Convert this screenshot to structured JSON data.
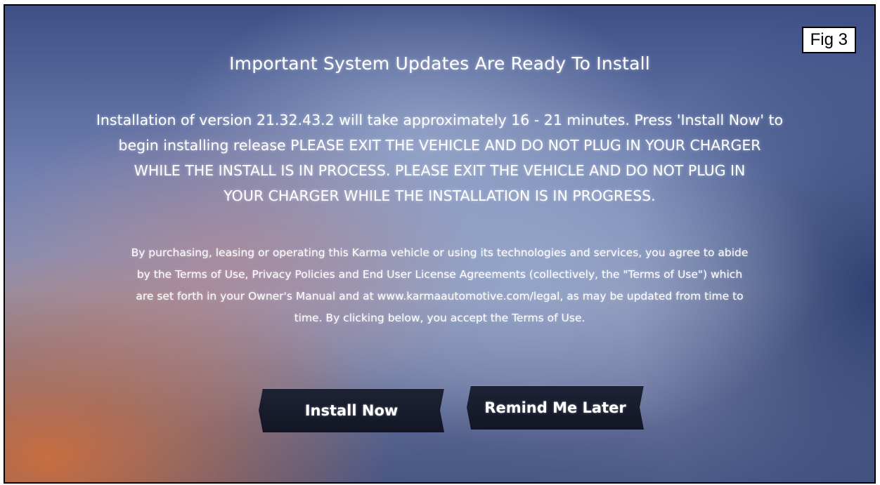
{
  "figure_label": "Fig 3",
  "dialog": {
    "title": "Important System Updates Are Ready To Install",
    "install_message_lines": [
      "Installation of version 21.32.43.2 will take approximately 16 - 21 minutes. Press 'Install Now' to",
      "begin installing release PLEASE EXIT THE VEHICLE AND DO NOT PLUG IN YOUR CHARGER",
      "WHILE THE INSTALL IS IN PROCESS. PLEASE EXIT THE VEHICLE AND DO NOT PLUG IN",
      "YOUR CHARGER WHILE THE INSTALLATION IS IN PROGRESS."
    ],
    "terms_lines": [
      "By purchasing, leasing or operating this Karma vehicle or using its technologies and services, you agree to abide",
      "by the Terms of Use, Privacy Policies and End User License Agreements (collectively, the \"Terms of Use\") which",
      "are set forth in your Owner's Manual and at www.karmaautomotive.com/legal, as may be updated from time to",
      "time.  By clicking below, you accept the Terms of Use."
    ],
    "buttons": {
      "install_now": "Install Now",
      "remind_later": "Remind Me Later"
    }
  }
}
